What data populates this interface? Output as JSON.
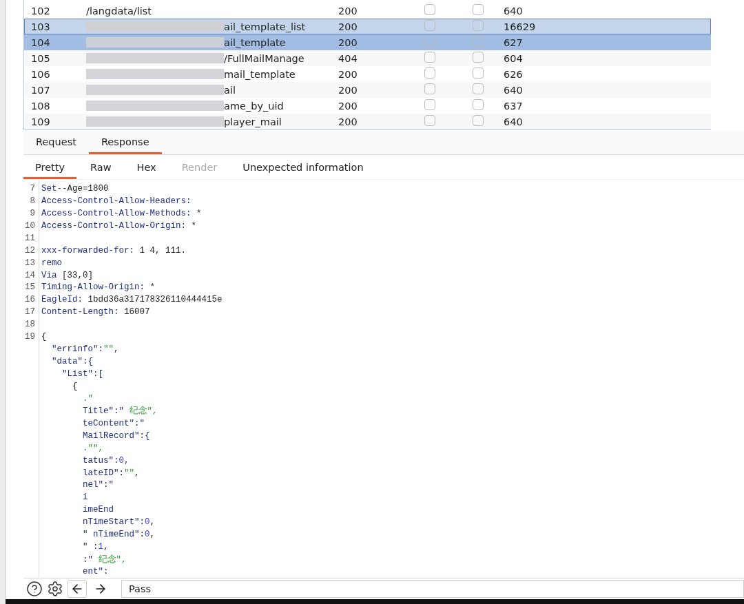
{
  "table": {
    "rows": [
      {
        "number": "102",
        "url": {
          "redacted": false,
          "text": "/langdata/list"
        },
        "status": "200",
        "check_1": false,
        "check_2": false,
        "length": "640",
        "selected": false,
        "focused": false
      },
      {
        "number": "103",
        "url": {
          "redacted": true,
          "text": "ail_template_list"
        },
        "status": "200",
        "check_1": false,
        "check_2": false,
        "length": "16629",
        "selected": true,
        "focused": true
      },
      {
        "number": "104",
        "url": {
          "redacted": true,
          "text": "ail_template"
        },
        "status": "200",
        "check_1": false,
        "check_2": false,
        "length": "627",
        "selected": true,
        "focused": false
      },
      {
        "number": "105",
        "url": {
          "redacted": true,
          "text": "/FullMailManage"
        },
        "status": "404",
        "check_1": false,
        "check_2": false,
        "length": "604",
        "selected": false,
        "focused": false
      },
      {
        "number": "106",
        "url": {
          "redacted": true,
          "text": "mail_template"
        },
        "status": "200",
        "check_1": false,
        "check_2": false,
        "length": "626",
        "selected": false,
        "focused": false
      },
      {
        "number": "107",
        "url": {
          "redacted": true,
          "text": "ail"
        },
        "status": "200",
        "check_1": false,
        "check_2": false,
        "length": "640",
        "selected": false,
        "focused": false
      },
      {
        "number": "108",
        "url": {
          "redacted": true,
          "text": "ame_by_uid"
        },
        "status": "200",
        "check_1": false,
        "check_2": false,
        "length": "637",
        "selected": false,
        "focused": false
      },
      {
        "number": "109",
        "url": {
          "redacted": true,
          "text": "player_mail"
        },
        "status": "200",
        "check_1": false,
        "check_2": false,
        "length": "640",
        "selected": false,
        "focused": false
      }
    ]
  },
  "tabs": [
    {
      "label": "Request",
      "selected": false
    },
    {
      "label": "Response",
      "selected": true
    }
  ],
  "view_tabs": [
    {
      "label": "Pretty",
      "selected": true,
      "disabled": false
    },
    {
      "label": "Raw",
      "selected": false,
      "disabled": false
    },
    {
      "label": "Hex",
      "selected": false,
      "disabled": false
    },
    {
      "label": "Render",
      "selected": false,
      "disabled": true
    },
    {
      "label": "Unexpected information",
      "selected": false,
      "disabled": false
    }
  ],
  "editor": {
    "lines": [
      {
        "number": "7",
        "segments": [
          {
            "kind": "key",
            "text": "Set-"
          },
          {
            "kind": "plain",
            "text": "-Age=1800"
          }
        ]
      },
      {
        "number": "8",
        "segments": [
          {
            "kind": "key",
            "text": "Access-Control-Allow-Headers:"
          }
        ]
      },
      {
        "number": "9",
        "segments": [
          {
            "kind": "key",
            "text": "Access-Control-Allow-Methods:"
          },
          {
            "kind": "plain",
            "text": " *"
          }
        ]
      },
      {
        "number": "10",
        "segments": [
          {
            "kind": "key",
            "text": "Access-Control-Allow-Origin:"
          },
          {
            "kind": "plain",
            "text": " *"
          }
        ]
      },
      {
        "number": "11"
      },
      {
        "number": "12",
        "segments": [
          {
            "kind": "key",
            "text": "xxx-forwarded-for:"
          },
          {
            "kind": "plain",
            "text": " 1 4, 111."
          }
        ]
      },
      {
        "number": "13",
        "segments": [
          {
            "kind": "key",
            "text": "remo"
          }
        ]
      },
      {
        "number": "14",
        "segments": [
          {
            "kind": "key",
            "text": "Via"
          },
          {
            "kind": "plain",
            "text": " [33,0]"
          }
        ]
      },
      {
        "number": "15",
        "segments": [
          {
            "kind": "key",
            "text": "Timing-Allow-Origin:"
          },
          {
            "kind": "plain",
            "text": " *"
          }
        ]
      },
      {
        "number": "16",
        "segments": [
          {
            "kind": "key",
            "text": "EagleId:"
          },
          {
            "kind": "plain",
            "text": " 1bdd36a317178326110444415e"
          }
        ]
      },
      {
        "number": "17",
        "segments": [
          {
            "kind": "key",
            "text": "Content-Length:"
          },
          {
            "kind": "plain",
            "text": " 16007"
          }
        ]
      },
      {
        "number": "18"
      },
      {
        "number": "19",
        "segments": [
          {
            "kind": "plain",
            "text": "{"
          }
        ],
        "children": [
          {
            "segments": [
              {
                "kind": "key",
                "text": "\"errinfo\":"
              },
              {
                "kind": "string",
                "text": "\"\""
              },
              {
                "kind": "plain",
                "text": ","
              }
            ]
          },
          {
            "segments": [
              {
                "kind": "key",
                "text": "\"data\":{"
              }
            ],
            "children": [
              {
                "segments": [
                  {
                    "kind": "key",
                    "text": "\"List\":["
                  }
                ],
                "children": [
                  {
                    "segments": [
                      {
                        "kind": "plain",
                        "text": "{"
                      }
                    ],
                    "children": [
                      {
                        "segments": [
                          {
                            "kind": "string",
                            "text": ".\""
                          }
                        ]
                      },
                      {
                        "segments": [
                          {
                            "kind": "key",
                            "text": "Title\":\""
                          },
                          {
                            "kind": "string",
                            "text": " 纪念\","
                          }
                        ]
                      },
                      {
                        "segments": [
                          {
                            "kind": "key",
                            "text": "teContent\":\""
                          }
                        ]
                      },
                      {
                        "segments": [
                          {
                            "kind": "key",
                            "text": "MailRecord\":{"
                          }
                        ]
                      },
                      {
                        "segments": [
                          {
                            "kind": "string",
                            "text": ".\"\","
                          }
                        ]
                      },
                      {
                        "segments": [
                          {
                            "kind": "key",
                            "text": "tatus\":"
                          },
                          {
                            "kind": "number",
                            "text": "0"
                          },
                          {
                            "kind": "plain",
                            "text": ","
                          }
                        ]
                      },
                      {
                        "segments": [
                          {
                            "kind": "key",
                            "text": "lateID\":"
                          },
                          {
                            "kind": "string",
                            "text": "\"\""
                          },
                          {
                            "kind": "plain",
                            "text": ","
                          }
                        ]
                      },
                      {
                        "segments": [
                          {
                            "kind": "key",
                            "text": "nel\":\""
                          }
                        ]
                      },
                      {
                        "segments": [
                          {
                            "kind": "key",
                            "text": "i"
                          }
                        ]
                      },
                      {
                        "segments": [
                          {
                            "kind": "key",
                            "text": "imeEnd"
                          }
                        ]
                      },
                      {
                        "segments": [
                          {
                            "kind": "key",
                            "text": "nTimeStart\":"
                          },
                          {
                            "kind": "number",
                            "text": "0"
                          },
                          {
                            "kind": "plain",
                            "text": ","
                          }
                        ]
                      },
                      {
                        "segments": [
                          {
                            "kind": "key",
                            "text": "\" nTimeEnd\":"
                          },
                          {
                            "kind": "number",
                            "text": "0"
                          },
                          {
                            "kind": "plain",
                            "text": ","
                          }
                        ]
                      },
                      {
                        "segments": [
                          {
                            "kind": "key",
                            "text": "\" :"
                          },
                          {
                            "kind": "number",
                            "text": "1"
                          },
                          {
                            "kind": "plain",
                            "text": ","
                          }
                        ]
                      },
                      {
                        "segments": [
                          {
                            "kind": "key",
                            "text": ":\""
                          },
                          {
                            "kind": "string",
                            "text": " 纪念\","
                          }
                        ]
                      },
                      {
                        "segments": [
                          {
                            "kind": "key",
                            "text": "ent\":"
                          }
                        ]
                      }
                    ]
                  }
                ]
              }
            ]
          }
        ]
      }
    ]
  },
  "footer": {
    "search": {
      "value": "Pass"
    }
  }
}
